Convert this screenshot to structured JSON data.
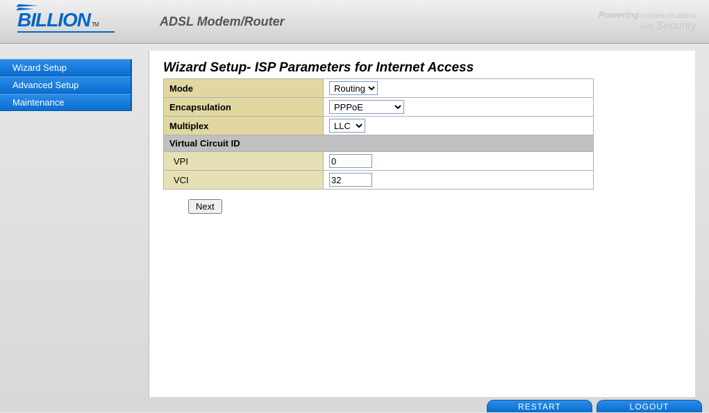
{
  "brand": {
    "logo_text": "BILLION",
    "tm": "TM",
    "product_title": "ADSL Modem/Router",
    "tagline_prefix": "Powering",
    "tagline_word": "communications",
    "tagline_with": "with",
    "tagline_security": "Security"
  },
  "sidebar": {
    "items": [
      {
        "label": "Wizard Setup"
      },
      {
        "label": "Advanced Setup"
      },
      {
        "label": "Maintenance"
      }
    ]
  },
  "page": {
    "title": "Wizard Setup- ISP Parameters for Internet Access",
    "rows": {
      "mode_label": "Mode",
      "mode_value": "Routing",
      "encap_label": "Encapsulation",
      "encap_value": "PPPoE",
      "multi_label": "Multiplex",
      "multi_value": "LLC",
      "section_vc": "Virtual Circuit ID",
      "vpi_label": "VPI",
      "vpi_value": "0",
      "vci_label": "VCI",
      "vci_value": "32"
    },
    "next_label": "Next"
  },
  "footer": {
    "restart": "RESTART",
    "logout": "LOGOUT"
  }
}
